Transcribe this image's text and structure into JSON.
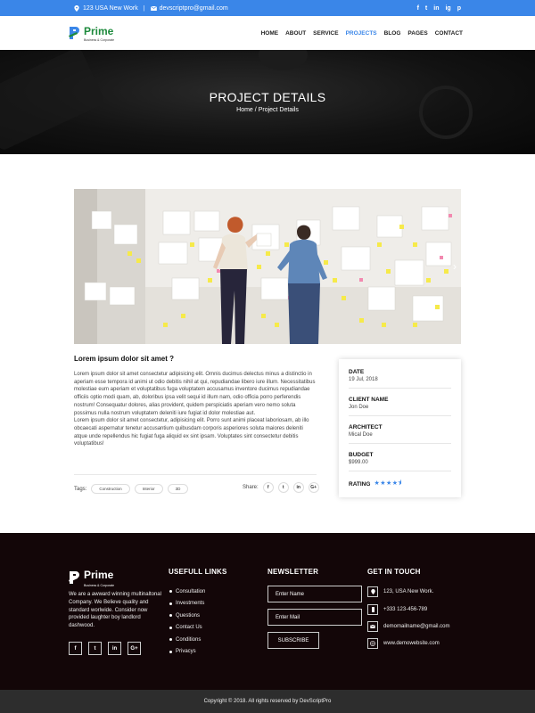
{
  "colors": {
    "accent": "#3a86e8",
    "brand_green": "#1d8a3c",
    "footer_bg": "#130608",
    "copyright_bg": "#2d2d2d"
  },
  "topbar": {
    "address": "123 USA New Work",
    "separator": "|",
    "email": "devscriptpro@gmail.com",
    "address_icon": "map-pin-icon",
    "email_icon": "envelope-icon",
    "social": [
      "f",
      "t",
      "in",
      "ig",
      "p"
    ]
  },
  "header": {
    "logo_name": "Prime",
    "logo_tagline": "Business & Corporate",
    "nav": [
      "HOME",
      "ABOUT",
      "SERVICE",
      "PROJECTS",
      "BLOG",
      "PAGES",
      "CONTACT"
    ],
    "active_nav": "PROJECTS"
  },
  "banner": {
    "title": "PROJECT DETAILS",
    "crumb_home": "Home",
    "crumb_sep": "/",
    "crumb_current": "Project Details"
  },
  "slider": {
    "next_icon": "›"
  },
  "project": {
    "heading": "Lorem ipsum dolor sit amet ?",
    "para1": "Lorem ipsum dolor sit amet consectetur adipisicing elit. Omnis ducimus delectus minus a distinctio in aperiam esse tempora id animi ut odio debitis nihil at qui, repudiandae libero iure illum. Necessitatibus molestiae eum aperiam et voluptatibus fuga voluptatem accusamus inventore ducimus repudiandae officiis optio modi quam, ab, doloribus ipsa velit sequi id illum nam, odio officia porro perferendis nostrum! Consequatur dolores, alias provident, quidem perspiciatis aperiam vero nemo soluta possimus nulla nostrum voluptatem deleniti iure fugiat id dolor molestiae aut.",
    "para2": "Lorem ipsum dolor sit amet consectetur, adipisicing elit. Porro sunt animi placeat laboriosam, ab illo obcaecati aspernatur tenetur accusantium quibusdam corporis asperiores soluta maiores deleniti atque unde repellendus hic fugiat fuga aliquid ex sint ipsam. Voluptates sint consectetur debitis voluptatibus!",
    "tags_label": "Tags:",
    "tags": [
      "Construction",
      "Interior",
      "3D"
    ],
    "share_label": "Share:",
    "share_icons": [
      "f",
      "t",
      "in",
      "G+"
    ]
  },
  "info": {
    "date_label": "DATE",
    "date": "19 Jul, 2018",
    "client_label": "CLIENT NAME",
    "client": "Jon Doe",
    "architect_label": "ARCHITECT",
    "architect": "Mical Doe",
    "budget_label": "BUDGET",
    "budget": "$999.00",
    "rating_label": "RATING",
    "rating": 4.5,
    "rating_max": 5
  },
  "footer": {
    "logo_name": "Prime",
    "logo_tagline": "Business & Corporate",
    "about": "We are a awward winning multinaltonal Company. We Believe quality and standard worlwide. Consider now provided laughter boy landlord dashwood.",
    "social": [
      "f",
      "t",
      "in",
      "G+"
    ],
    "links_heading": "USEFULL LINKS",
    "links": [
      "Consultation",
      "Investments",
      "Questions",
      "Contact Us",
      "Conditions",
      "Privacys"
    ],
    "newsletter_heading": "NEWSLETTER",
    "name_placeholder": "Enter Name",
    "mail_placeholder": "Enter Mail",
    "subscribe": "SUBSCRIBE",
    "touch_heading": "GET IN TOUCH",
    "address": "123, USA New Work.",
    "phone": "+333 123-456-789",
    "email": "demomailname@gmail.com",
    "website": "www.demowebsite.com"
  },
  "copyright": "Copyright © 2018. All rights reserved by DevScriptPro"
}
